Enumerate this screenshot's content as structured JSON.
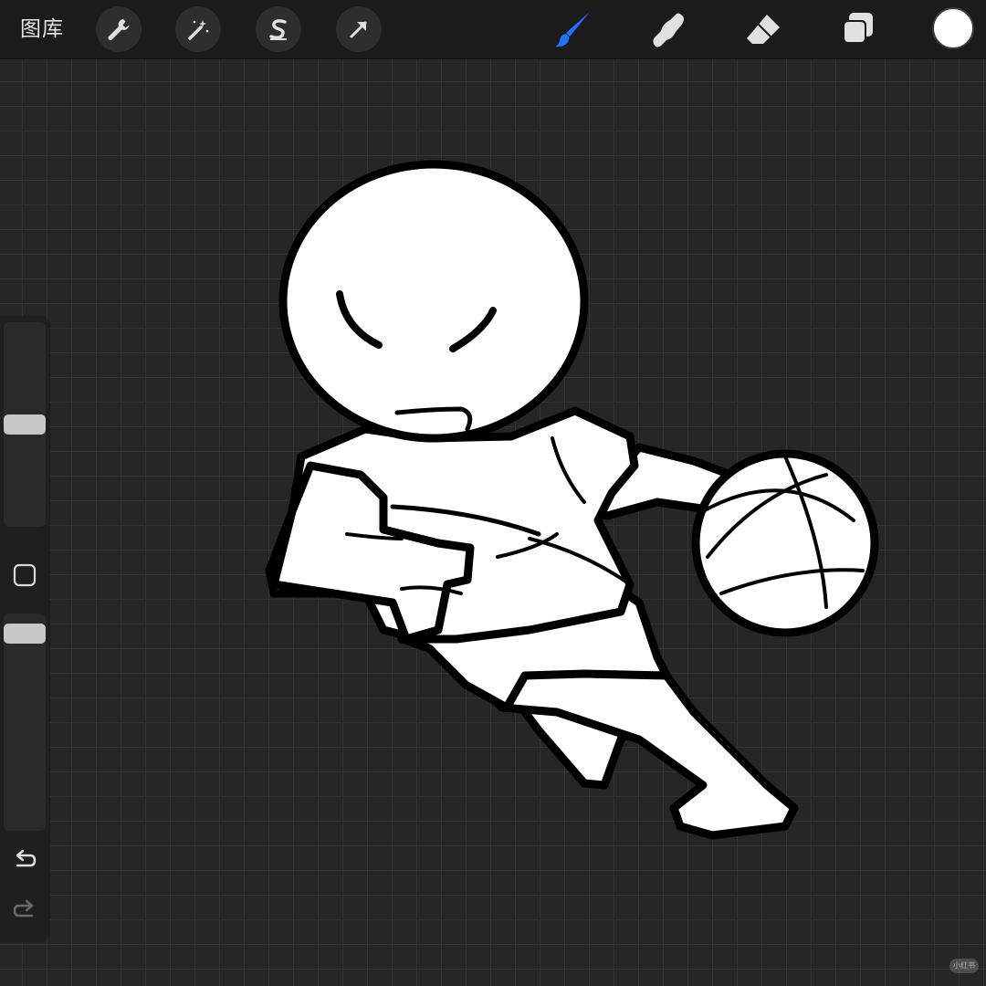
{
  "topbar": {
    "gallery_label": "图库",
    "tools_left": [
      {
        "name": "actions",
        "icon": "wrench-icon"
      },
      {
        "name": "adjustments",
        "icon": "magic-wand-icon"
      },
      {
        "name": "selection",
        "icon": "selection-s-icon"
      },
      {
        "name": "transform",
        "icon": "transform-arrow-icon"
      }
    ],
    "tools_right": [
      {
        "name": "brush",
        "icon": "brush-icon",
        "active": true
      },
      {
        "name": "smudge",
        "icon": "smudge-finger-icon"
      },
      {
        "name": "eraser",
        "icon": "eraser-icon"
      },
      {
        "name": "layers",
        "icon": "layers-icon"
      }
    ],
    "current_color": "#ffffff",
    "accent_color": "#1e73ff"
  },
  "sidebar": {
    "brush_size_level": 0.5,
    "opacity_level": 0.95,
    "modify_icon": "square-modify-icon",
    "undo_icon": "undo-icon",
    "redo_icon": "redo-icon"
  },
  "canvas": {
    "subject": "basketball-player-sketch"
  },
  "watermark": {
    "text": "小红书"
  }
}
